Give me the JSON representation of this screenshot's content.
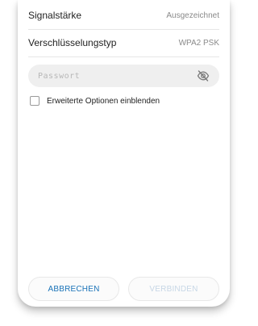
{
  "info": {
    "signal_label": "Signalstärke",
    "signal_value": "Ausgezeichnet",
    "encryption_label": "Verschlüsselungstyp",
    "encryption_value": "WPA2 PSK"
  },
  "password": {
    "placeholder": "Passwort",
    "value": "",
    "visibility_icon": "eye-off-icon"
  },
  "advanced": {
    "label": "Erweiterte Optionen einblenden",
    "checked": false
  },
  "actions": {
    "cancel_label": "ABBRECHEN",
    "connect_label": "VERBINDEN",
    "connect_enabled": false
  },
  "colors": {
    "accent": "#1a73b8",
    "disabled_text": "#c7d7e6",
    "field_bg": "#efefef"
  }
}
